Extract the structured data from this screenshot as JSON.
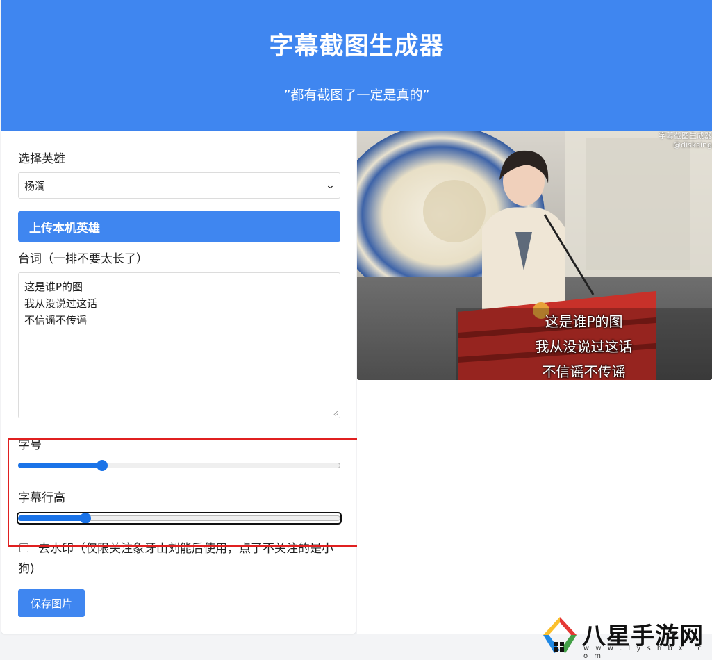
{
  "header": {
    "title": "字幕截图生成器",
    "subtitle": "”都有截图了一定是真的”"
  },
  "form": {
    "hero_label": "选择英雄",
    "hero_selected": "杨澜",
    "upload_button": "上传本机英雄",
    "lines_label": "台词（一排不要太长了）",
    "lines": [
      "这是谁P的图",
      "我从没说过这话",
      "不信谣不传谣"
    ],
    "font_size_label": "字号",
    "font_size_level": 0.26,
    "line_height_label": "字幕行高",
    "line_height_level": 0.21,
    "watermark_checkbox_text": "去水印（仅限关注象牙山刘能后使用，点了不关注的是小狗)",
    "watermark_checked": false,
    "save_button": "保存图片"
  },
  "preview": {
    "corner_watermark_line1": "字幕截图生成器",
    "corner_watermark_line2": "@disksing",
    "subtitles": [
      "这是谁P的图",
      "我从没说过这话",
      "不信谣不传谣"
    ]
  },
  "site_logo": {
    "brand": "八星手游网",
    "domain": "w w w . l y s h b x . c o m"
  },
  "colors": {
    "primary": "#3f86f0",
    "slider": "#1a73e8",
    "highlight_box": "#e02020"
  }
}
